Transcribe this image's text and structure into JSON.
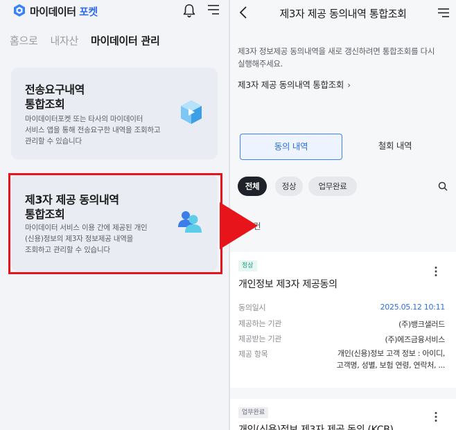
{
  "left": {
    "brand": {
      "main": "마이데이터",
      "accent": "포켓"
    },
    "tabs": [
      {
        "label": "홈으로",
        "active": false
      },
      {
        "label": "내자산",
        "active": false
      },
      {
        "label": "마이데이터 관리",
        "active": true
      }
    ],
    "cards": [
      {
        "title_line1": "전송요구내역",
        "title_line2": "통합조회",
        "desc_line1": "마이데이터포켓 또는 타사의 마이데이터",
        "desc_line2": "서비스 앱을 통해 전송요구한 내역을 조회하고",
        "desc_line3": "관리할 수 있습니다",
        "icon": "data-cube-icon"
      },
      {
        "title_line1": "제3자 제공 동의내역",
        "title_line2": "통합조회",
        "desc_line1": "마이데이터 서비스 이용 간에 제공된 개인",
        "desc_line2": "(신용)정보의 제3자 정보제공 내역을",
        "desc_line3": "조회하고 관리할 수 있습니다",
        "icon": "users-icon"
      }
    ],
    "highlight_color": "#e8141c"
  },
  "right": {
    "title": "제3자 제공 동의내역 통합조회",
    "notice_line1": "제3자 정보제공 동의내역을 새로 갱신하려면 통합조회를 다시",
    "notice_line2": "실행해주세요.",
    "notice_link": "제3자 제공 동의내역 통합조회",
    "segments": {
      "on": "동의 내역",
      "off": "철회 내역"
    },
    "chips": {
      "all": "전체",
      "normal": "정상",
      "done": "업무완료"
    },
    "count": "총 3건",
    "items": [
      {
        "badge": "정상",
        "title": "개인정보 제3자 제공동의",
        "rows": [
          {
            "label": "동의일시",
            "value": "2025.05.12 10:11"
          },
          {
            "label": "제공하는 기관",
            "value": "(주)뱅크샐러드"
          },
          {
            "label": "제공받는 기관",
            "value": "(주)에즈금융서비스"
          },
          {
            "label": "제공 항목",
            "value_line1": "개인(신용)정보 고객 정보 : 아이디,",
            "value_line2": "고객명, 성별, 보험 연령, 연락처, ..."
          }
        ]
      },
      {
        "badge": "업무완료",
        "title": "개인(신용)정보 제3자 제공 동의 (KCB)"
      }
    ],
    "accent": "#2b6fe2"
  },
  "arrow_color": "#e8141c"
}
